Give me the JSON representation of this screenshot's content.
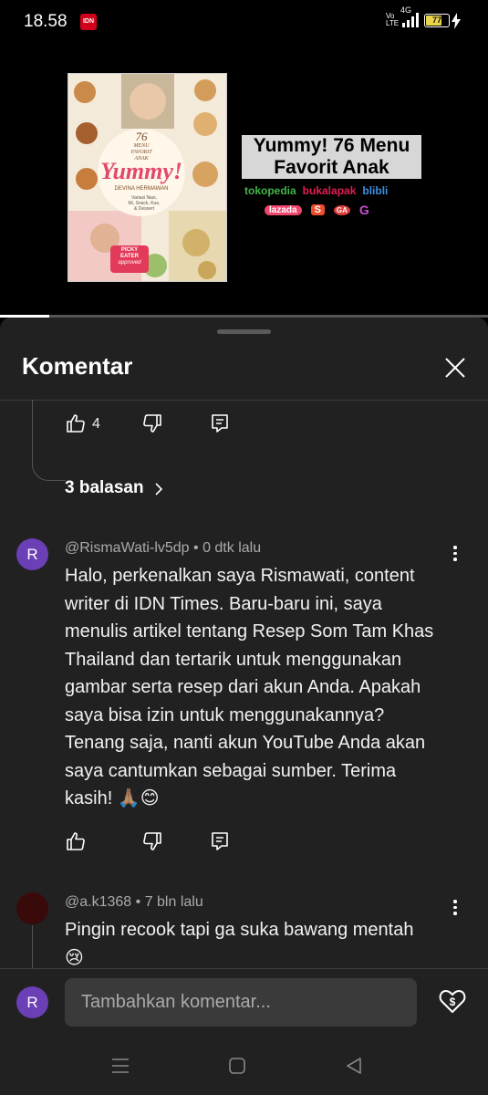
{
  "status_bar": {
    "time": "18.58",
    "notification_badge": "IDN",
    "network": "4G",
    "volte": "Vo LTE",
    "battery": "77"
  },
  "video": {
    "book_title_lines": [
      "76",
      "MENU",
      "FAVORIT",
      "ANAK"
    ],
    "book_brand": "Yummy!",
    "book_author": "DEVINA HERMAWAN",
    "book_tagline": [
      "Variasi Nasi,",
      "Mi, Snack, Kue,",
      "& Dessert"
    ],
    "book_badge": [
      "PICKY",
      "EATER",
      "approved"
    ],
    "promo_title": [
      "Yummy! 76 Menu",
      "Favorit Anak"
    ],
    "shops_row1": [
      "tokopedia",
      "bukalapak",
      "blibli"
    ],
    "shops_row2": [
      "lazada",
      "S",
      "GA",
      "G"
    ],
    "progress_fraction": 0.1
  },
  "comments_panel": {
    "title": "Komentar",
    "prev_comment_likes": "4",
    "replies_label": "3 balasan",
    "comments": [
      {
        "avatar_letter": "R",
        "author": "@RismaWati-lv5dp",
        "time": "0 dtk lalu",
        "text_lines": [
          "Halo, perkenalkan saya Rismawati, content",
          "writer di IDN Times. Baru-baru ini, saya",
          "menulis artikel tentang Resep Som Tam Khas",
          "Thailand dan tertarik untuk menggunakan",
          "gambar serta resep dari akun Anda. Apakah",
          "saya bisa izin untuk menggunakannya?",
          "Tenang saja, nanti akun YouTube Anda akan",
          "saya cantumkan sebagai sumber. Terima",
          "kasih! 🙏🏽😊"
        ]
      },
      {
        "author": "@a.k1368",
        "time": "7 bln lalu",
        "text_lines": [
          "Pingin recook tapi ga suka bawang mentah",
          "😢"
        ]
      }
    ],
    "composer": {
      "avatar_letter": "R",
      "placeholder": "Tambahkan komentar..."
    }
  },
  "colors": {
    "sheet_bg": "#212121",
    "avatar_bg": "#6b3fb5",
    "input_bg": "#3a3a3a"
  },
  "icons": [
    "like-icon",
    "dislike-icon",
    "reply-icon",
    "more-icon",
    "close-icon",
    "super-thanks-icon",
    "chevron-right-icon",
    "recents-icon",
    "home-icon",
    "back-icon"
  ]
}
